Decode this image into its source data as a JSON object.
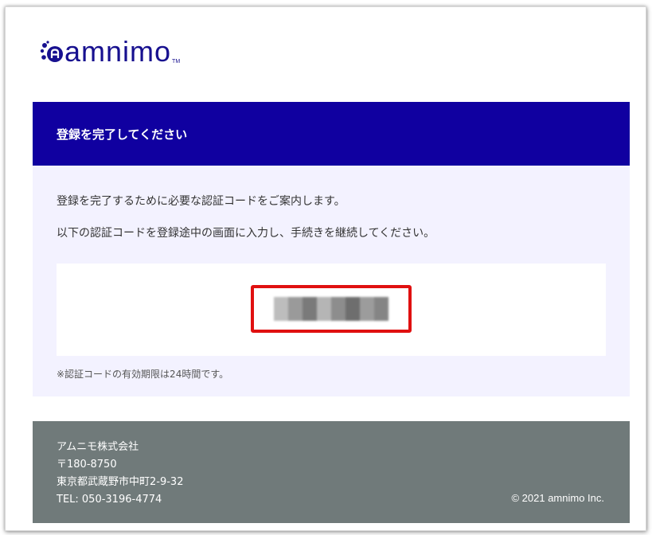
{
  "logo": {
    "text": "amnimo",
    "tm": "TM"
  },
  "header": {
    "title": "登録を完了してください"
  },
  "content": {
    "paragraph1": "登録を完了するために必要な認証コードをご案内します。",
    "paragraph2": "以下の認証コードを登録途中の画面に入力し、手続きを継続してください。",
    "note": "※認証コードの有効期限は24時間です。"
  },
  "verification_code": {
    "state": "blurred"
  },
  "footer": {
    "company": "アムニモ株式会社",
    "postal": "〒180-8750",
    "address": "東京都武蔵野市中町2-9-32",
    "tel": "TEL: 050-3196-4774",
    "copyright": "© 2021 amnimo Inc."
  },
  "colors": {
    "brand": "#17108f",
    "header_bg": "#1000a0",
    "content_bg": "#f3f2ff",
    "highlight": "#e01010",
    "footer_bg": "#707a7a"
  }
}
